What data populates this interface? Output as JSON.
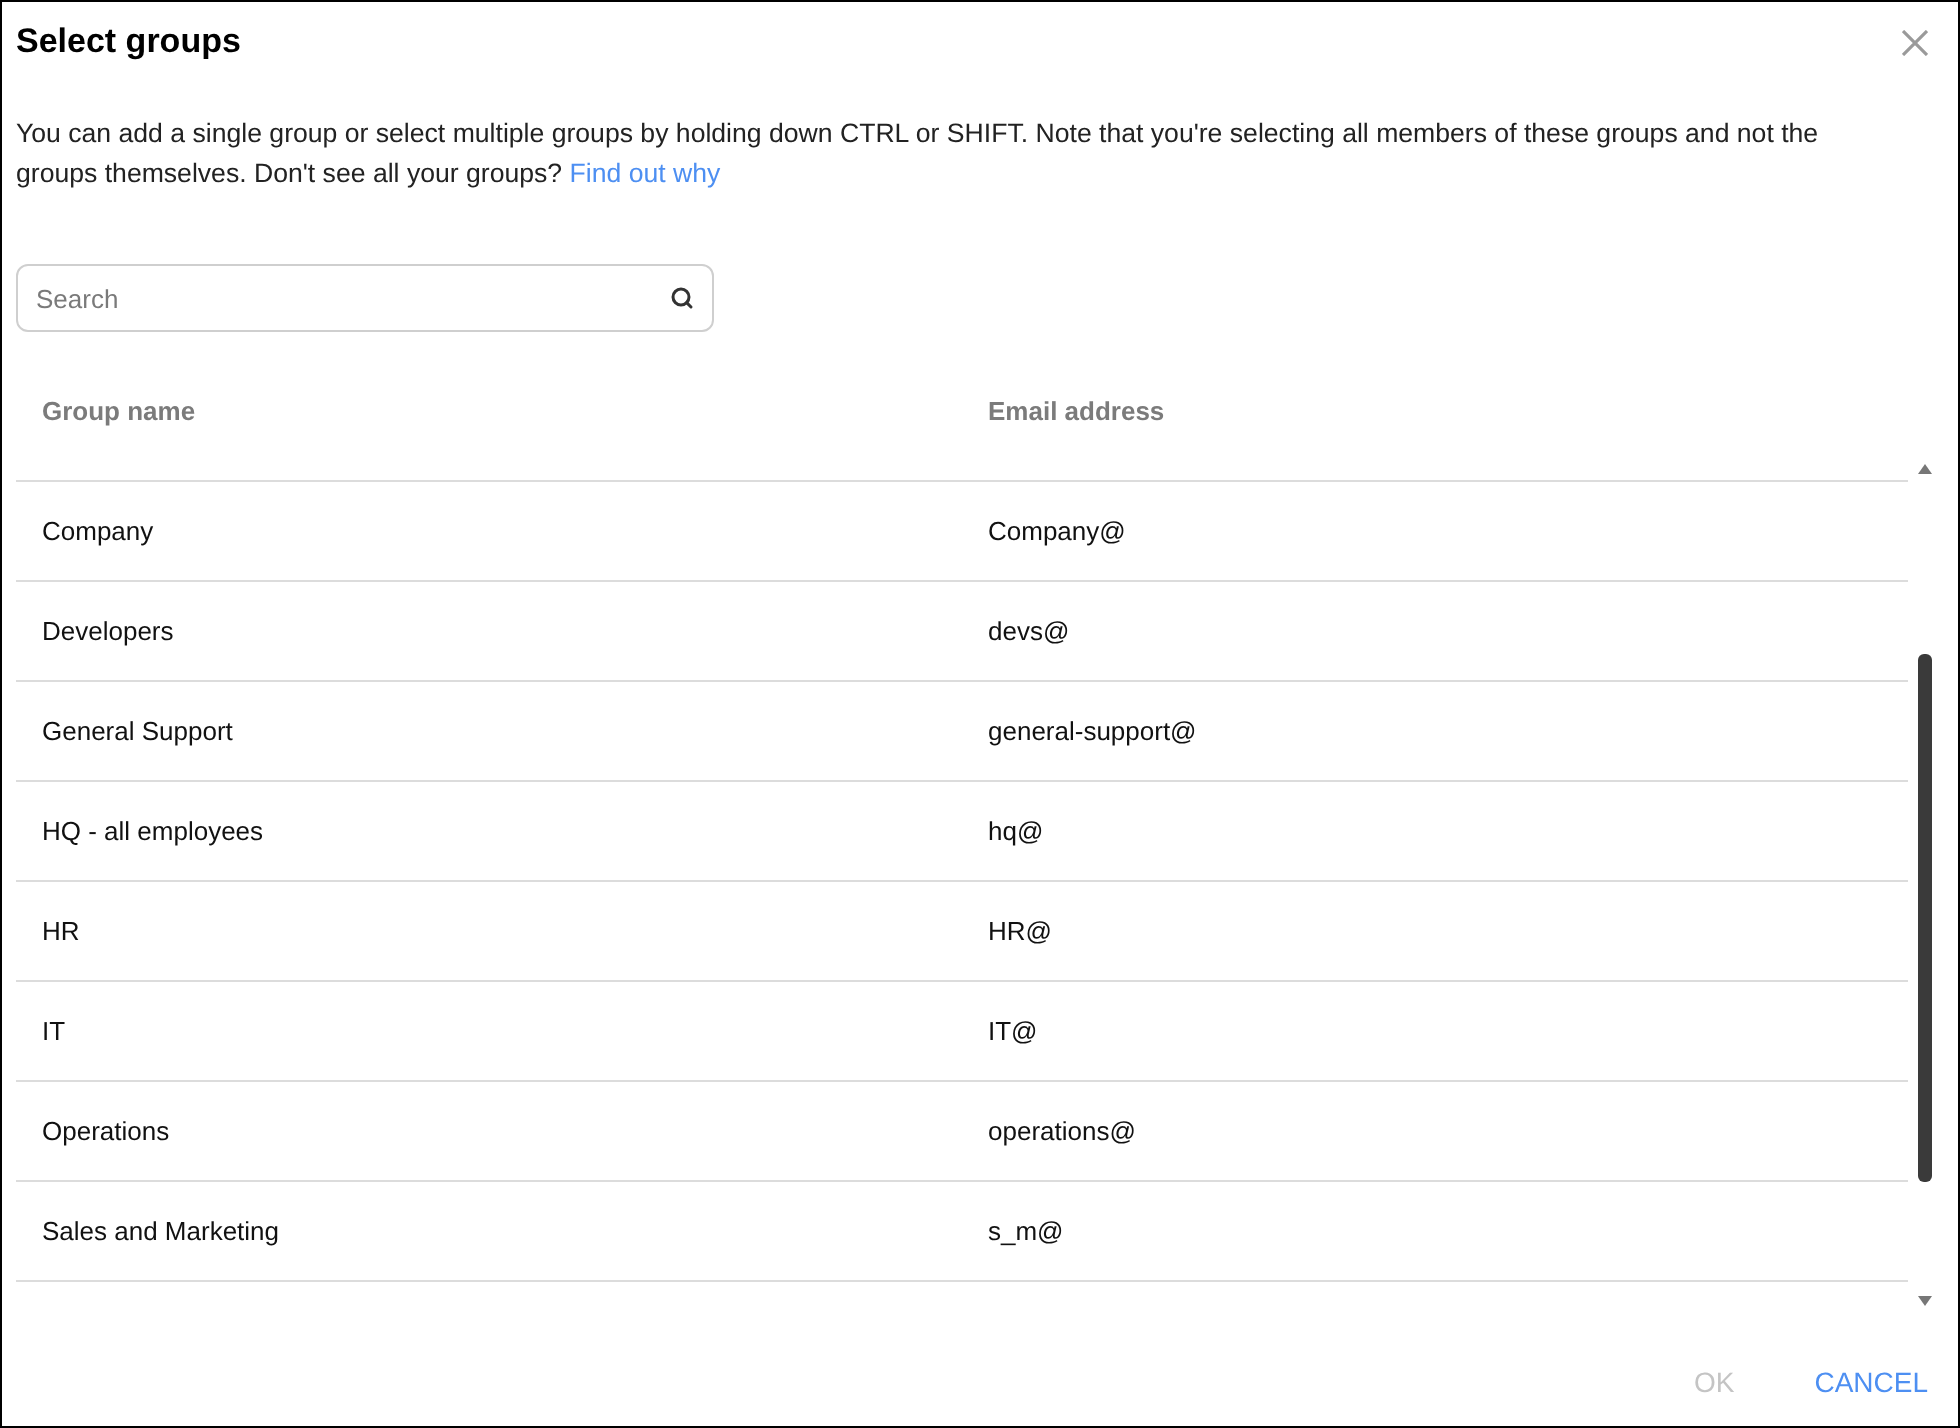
{
  "dialog": {
    "title": "Select groups",
    "description": {
      "text": "You can add a single group or select multiple groups by holding down CTRL or SHIFT. Note that you're selecting all members of these groups and not the groups themselves. Don't see all your groups?",
      "link": "Find out why"
    }
  },
  "search": {
    "placeholder": "Search"
  },
  "table": {
    "columns": [
      "Group name",
      "Email address"
    ],
    "rows": [
      {
        "name": "Company",
        "email": "Company@",
        "selected": false
      },
      {
        "name": "Developers",
        "email": "devs@",
        "selected": false
      },
      {
        "name": "General Support",
        "email": "general-support@",
        "selected": false
      },
      {
        "name": "HQ - all employees",
        "email": "hq@",
        "selected": false
      },
      {
        "name": "HR",
        "email": "HR@",
        "selected": false
      },
      {
        "name": "IT",
        "email": "IT@",
        "selected": false
      },
      {
        "name": "Operations",
        "email": "operations@",
        "selected": false
      },
      {
        "name": "Sales and Marketing",
        "email": "s_m@",
        "selected": false
      }
    ]
  },
  "buttons": [
    {
      "label": "OK",
      "disabled": true
    },
    {
      "label": "CANCEL",
      "disabled": false
    }
  ]
}
